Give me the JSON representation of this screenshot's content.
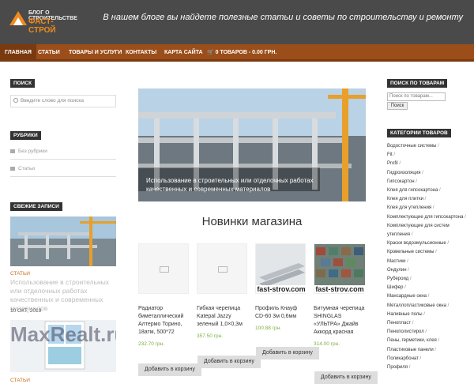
{
  "header": {
    "logo_top": "БЛОГ О СТРОИТЕЛЬСТВЕ",
    "logo_bottom": "ФАСТ-СТРОЙ",
    "tagline": "В нашем блоге вы найдете полезные статьи и советы по строительству и ремонту"
  },
  "nav": [
    {
      "label": "ГЛАВНАЯ"
    },
    {
      "label": "СТАТЬИ"
    },
    {
      "label": "ТОВАРЫ И УСЛУГИ"
    },
    {
      "label": "КОНТАКТЫ"
    },
    {
      "label": "КАРТА САЙТА"
    },
    {
      "label": "0 ТОВАРОВ - 0.00 ГРН."
    }
  ],
  "left": {
    "search_title": "ПОИСК",
    "search_placeholder": "Введите слово для поиска",
    "rubrics_title": "РУБРИКИ",
    "rubrics": [
      "Без рубрики",
      "Статьи"
    ],
    "recent_title": "СВЕЖИЕ ЗАПИСИ",
    "recent_category": "СТАТЬИ",
    "recent_post": "Использование в строительных или отделочных работах качественных и современных материалов",
    "recent_date": "10 ОКТ, 2019",
    "maxrealt": "MaxRealt.ru",
    "second_category": "СТАТЬИ"
  },
  "main": {
    "hero_caption": "Использование в строительных или отделочных работах качественных и современных материалов",
    "shop_title": "Новинки магазина",
    "image_text": "fast-strov.com",
    "cart_label": "Добавить в корзину",
    "products": [
      {
        "name": "Радиатор биметаллический Алтермо Торино, 18атм, 500*72",
        "price": "232.70 грн."
      },
      {
        "name": "Гибкая черепица Katepal Jazzy зеленый 1,0×0,3м",
        "price": "357.50 грн."
      },
      {
        "name": "Профиль Кнауф CD-60 3м 0,6мм",
        "price": "100.88 грн."
      },
      {
        "name": "Битумная черепица SHINGLAS «УЛЬТРА» Джайв Аккорд красная",
        "price": "314.00 грн."
      }
    ]
  },
  "right": {
    "product_search_title": "ПОИСК ПО ТОВАРАМ",
    "product_search_placeholder": "Поиск по товарам...",
    "product_search_button": "Поиск",
    "categories_title": "КАТЕГОРИИ ТОВАРОВ",
    "categories": [
      "Водосточные системы",
      "Fit",
      "Profil",
      "Гидроизоляция",
      "Гипсокартон",
      "Клея для гипсокартона",
      "Клея для плитки",
      "Клея для утепления",
      "Комплектующие для гипсокартона",
      "Комплектующие для систем утепления",
      "Краски водоэмульсионные",
      "Кровельные системы",
      "Мастики",
      "Ондулин",
      "Рубероид",
      "Шифер",
      "Мансардные окна",
      "Металлопластиковые окна",
      "Наливные полы",
      "Пенопласт",
      "Пенополистирол",
      "Пены, герметики, клея",
      "Пластиковые панели",
      "Поликарбонат",
      "Профиля"
    ]
  },
  "colors": {
    "header": "#4a4a4a",
    "nav": "#9b4e1a",
    "accent": "#f08a1c",
    "price": "#7fae3e"
  }
}
